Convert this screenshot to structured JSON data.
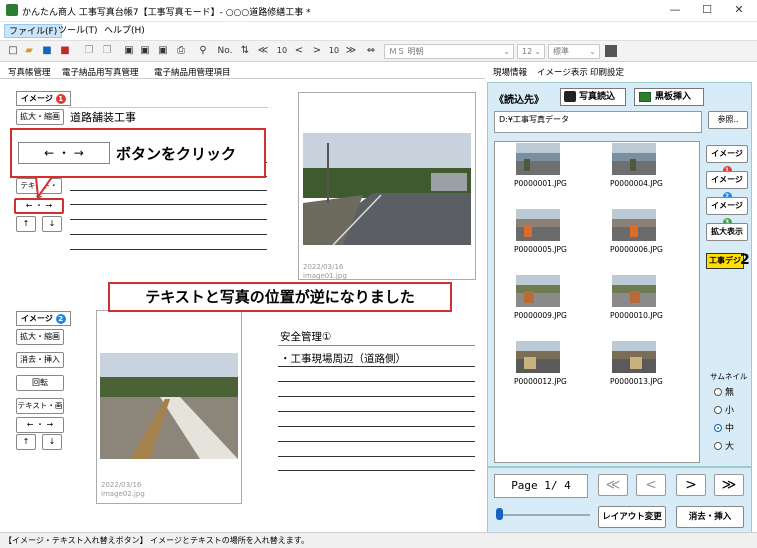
{
  "window": {
    "title": "かんたん商人 工事写真台帳7【工事写真モード】- ○○○道路修繕工事 *",
    "minimize": "—",
    "maximize": "☐",
    "close": "✕"
  },
  "menu": {
    "file": "ファイル(F)",
    "tools": "ツール(T)",
    "help": "ヘルプ(H)"
  },
  "toolbar": {
    "font_name": "ＭＳ 明朝",
    "font_size": "12",
    "style": "標準",
    "nav_first": "≪",
    "nav_prev10": "10",
    "nav_prev": "<",
    "nav_next": ">",
    "nav_next10": "10",
    "nav_last": "≫",
    "number_icon_label": "No."
  },
  "tabs": {
    "left": [
      "写真帳管理",
      "電子納品用写真管理",
      "電子納品用管理項目"
    ],
    "right": [
      "現場情報",
      "イメージ表示",
      "印刷設定"
    ]
  },
  "page_top": {
    "image_badge": "イメージ",
    "image_num": "1",
    "zoom_button": "拡大・縮画",
    "text_title": "道路舗装工事",
    "text_image_button": "テキスト・画",
    "swap_button": "← ・ →",
    "up": "↑",
    "down": "↓",
    "photo_caption": [
      "2022/03/16",
      "image01.jpg"
    ]
  },
  "page_bottom": {
    "image_badge": "イメージ",
    "image_num": "2",
    "zoom_button": "拡大・縮画",
    "delete_insert_button": "消去・挿入",
    "rotate_button": "回転",
    "text_image_button": "テキスト・画",
    "swap_button": "← ・ →",
    "up": "↑",
    "down": "↓",
    "text_title": "安全管理①",
    "text_line1": "・工事現場周辺（道路側）",
    "photo_caption": [
      "2022/03/16",
      "image02.jpg"
    ]
  },
  "callouts": {
    "click": "ボタンをクリック",
    "swap_arrow": "←  ・  →",
    "result": "テキストと写真の位置が逆になりました"
  },
  "right_panel": {
    "load_label": "《読込先》",
    "photo_load_button": "写真読込",
    "board_insert_button": "黒板挿入",
    "path": "D:¥工事写真データ",
    "browse_button": "参照..",
    "thumbnails": [
      "P0000001.JPG",
      "P0000004.JPG",
      "P0000005.JPG",
      "P0000006.JPG",
      "P0000009.JPG",
      "P0000010.JPG",
      "P0000012.JPG",
      "P0000013.JPG"
    ],
    "image_buttons": [
      {
        "label": "イメージ",
        "num": "1",
        "color": "#e53935"
      },
      {
        "label": "イメージ",
        "num": "2",
        "color": "#1e88e5"
      },
      {
        "label": "イメージ",
        "num": "3",
        "color": "#43a047"
      }
    ],
    "zoom_display_button": "拡大表示",
    "kouji_badge": "工事デジ",
    "kouji_num": "2",
    "thumbnail_label": "サムネイル",
    "thumbnail_options": [
      "無",
      "小",
      "中",
      "大"
    ],
    "thumbnail_selected": "中"
  },
  "nav": {
    "page_text": "Page  1/ 4",
    "first": "≪",
    "prev": "<",
    "next": ">",
    "last": "≫",
    "layout_button": "レイアウト変更",
    "delete_insert_button": "消去・挿入"
  },
  "status": {
    "text": "【イメージ・テキスト入れ替えボタン】 イメージとテキストの場所を入れ替えます。"
  },
  "colors": {
    "accent_red": "#d32f2f",
    "panel_bg": "#d8ecf7"
  }
}
